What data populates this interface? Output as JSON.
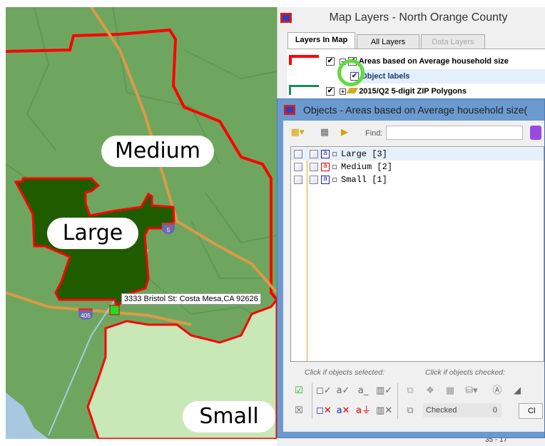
{
  "map": {
    "labels": {
      "medium": "Medium",
      "large": "Large",
      "small": "Small"
    },
    "callout": "3333 Bristol St: Costa Mesa,CA 92626",
    "highway_shields": [
      "5",
      "405"
    ],
    "colors": {
      "base": "#6fa65f",
      "large": "#1f5c00",
      "small": "#c9e8b8",
      "boundary": "#ff0000",
      "water": "#a8c8e0"
    }
  },
  "map_layers": {
    "title": "Map Layers - North Orange County",
    "tabs": [
      {
        "label": "Layers In Map",
        "active": true
      },
      {
        "label": "All Layers"
      },
      {
        "label": "Data Layers",
        "disabled": true
      }
    ],
    "layers": [
      {
        "label": "Areas based on Average household size",
        "checked": true
      },
      {
        "label": "Object labels",
        "checked": true,
        "selected": true
      },
      {
        "label": "2015/Q2 5-digit ZIP Polygons",
        "checked": true
      }
    ]
  },
  "objects": {
    "title": "Objects - Areas based on Average household size(",
    "find_label": "Find:",
    "find_value": "",
    "items": [
      {
        "label": "Large [3]",
        "selected": true
      },
      {
        "label": "Medium [2]"
      },
      {
        "label": "Small [1]"
      }
    ],
    "hint_selected": "Click if objects selected:",
    "hint_checked": "Click if objects checked:",
    "checked_label": "Checked",
    "checked_count": "0",
    "close_label": "Cl"
  },
  "bottom": {
    "range": "35 - 17"
  }
}
